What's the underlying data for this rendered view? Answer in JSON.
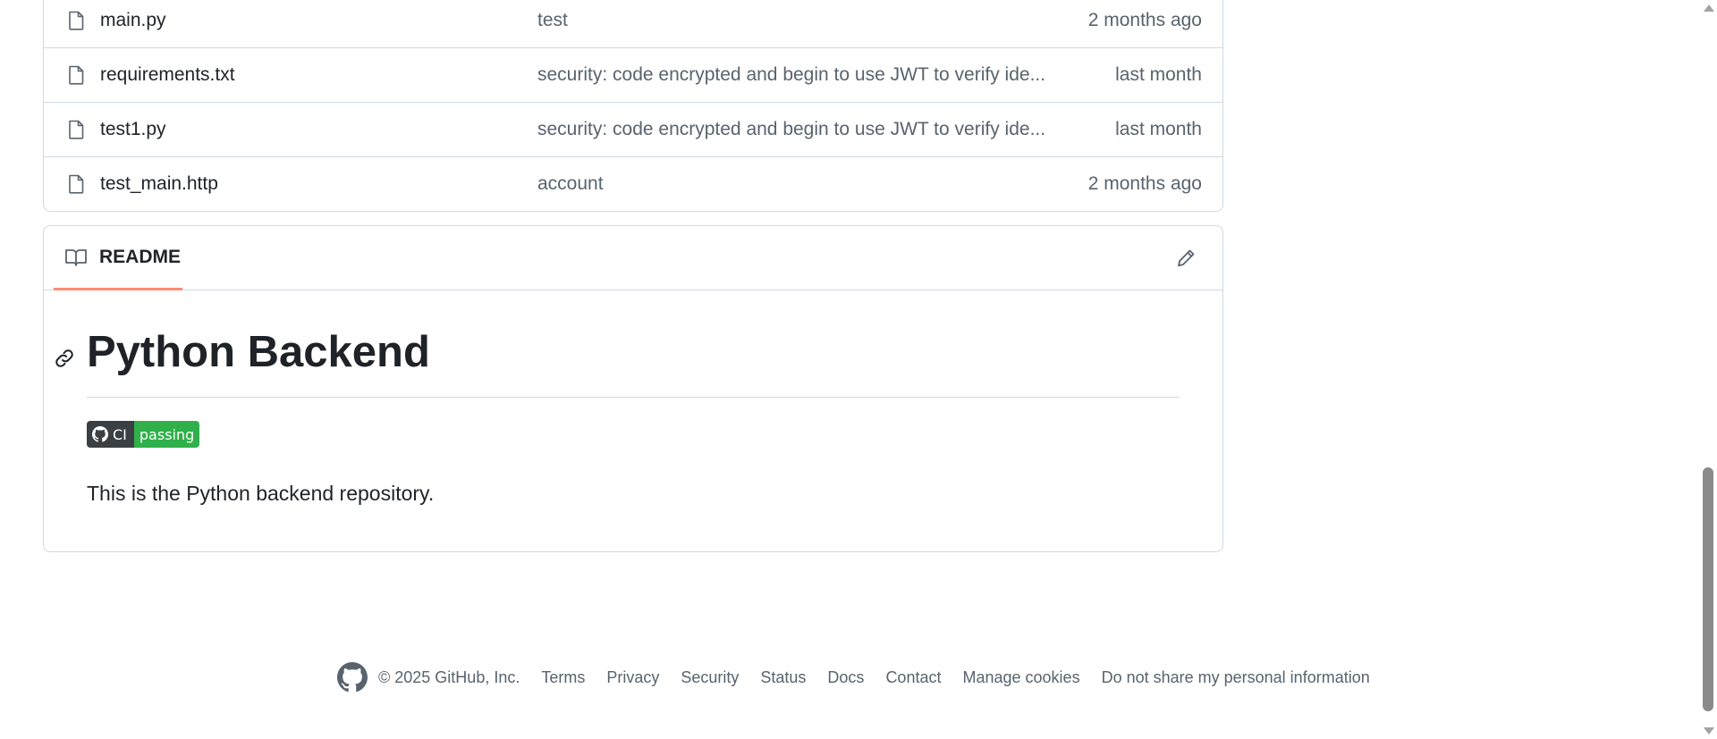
{
  "files": [
    {
      "name": "main.py",
      "message": "test",
      "time": "2 months ago"
    },
    {
      "name": "requirements.txt",
      "message": "security: code encrypted and begin to use JWT to verify ide...",
      "time": "last month"
    },
    {
      "name": "test1.py",
      "message": "security: code encrypted and begin to use JWT to verify ide...",
      "time": "last month"
    },
    {
      "name": "test_main.http",
      "message": "account",
      "time": "2 months ago"
    }
  ],
  "readme": {
    "tab_label": "README",
    "title": "Python Backend",
    "badge_left": "CI",
    "badge_right": "passing",
    "text": "This is the Python backend repository."
  },
  "footer": {
    "copyright": "© 2025 GitHub, Inc.",
    "links": [
      "Terms",
      "Privacy",
      "Security",
      "Status",
      "Docs",
      "Contact",
      "Manage cookies",
      "Do not share my personal information"
    ]
  },
  "colors": {
    "tab_underline": "#fd8c73",
    "badge_passing": "#2fb04a",
    "badge_label": "#3a3f44",
    "muted_text": "#59636e",
    "border": "#d1d9e0"
  },
  "icons": {
    "file": "file-icon",
    "readme": "book-icon",
    "edit": "pencil-icon",
    "anchor": "link-icon",
    "footer_logo": "github-logo-icon"
  }
}
